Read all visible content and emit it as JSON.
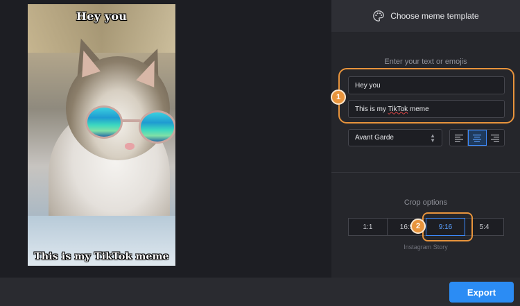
{
  "meme": {
    "top_text": "Hey you",
    "bottom_text": "This is my TikTok meme"
  },
  "panel": {
    "header_label": "Choose meme template",
    "header_icon": "palette-icon",
    "text_section_label": "Enter your text or emojis",
    "text_field_1_value": "Hey you",
    "text_field_2_value_prefix": "This is my ",
    "text_field_2_value_flagged": "TikTok",
    "text_field_2_value_suffix": " meme",
    "font_select_value": "Avant Garde",
    "align_options": [
      "align-left-icon",
      "align-center-icon",
      "align-right-icon"
    ],
    "align_selected": "center",
    "crop_section_label": "Crop options",
    "crop_options": [
      "1:1",
      "16:9",
      "9:16",
      "5:4"
    ],
    "crop_selected": "9:16",
    "crop_caption": "Instagram Story"
  },
  "annotations": {
    "step_1": "1",
    "step_2": "2"
  },
  "footer": {
    "export_label": "Export"
  },
  "colors": {
    "accent": "#2b8cf4",
    "annotation": "#e8943c",
    "background": "#1d1e23",
    "panel": "#25262b"
  }
}
